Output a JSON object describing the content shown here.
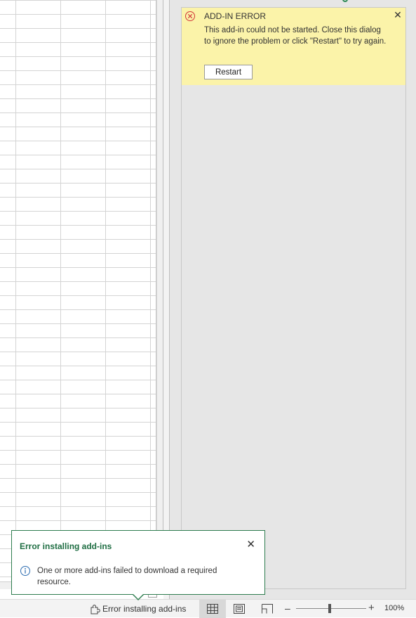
{
  "task_pane": {
    "error_banner": {
      "title": "ADD-IN ERROR",
      "message": "This add-in could not be started. Close this dialog to ignore the problem or click \"Restart\" to try again.",
      "restart_label": "Restart",
      "close_glyph": "✕",
      "background_color": "#fbf3a9",
      "icon": "error-circle-icon"
    }
  },
  "notification": {
    "title": "Error installing add-ins",
    "message": "One or more add-ins failed to download a required resource.",
    "close_glyph": "✕",
    "accent_color": "#1f6e43",
    "icon": "info-icon"
  },
  "status_bar": {
    "error_text": "Error installing add-ins",
    "zoom_minus": "–",
    "zoom_plus": "+",
    "zoom_level": "100%",
    "views": [
      "normal-view-icon",
      "page-layout-view-icon",
      "page-break-view-icon"
    ],
    "active_view": "normal"
  }
}
